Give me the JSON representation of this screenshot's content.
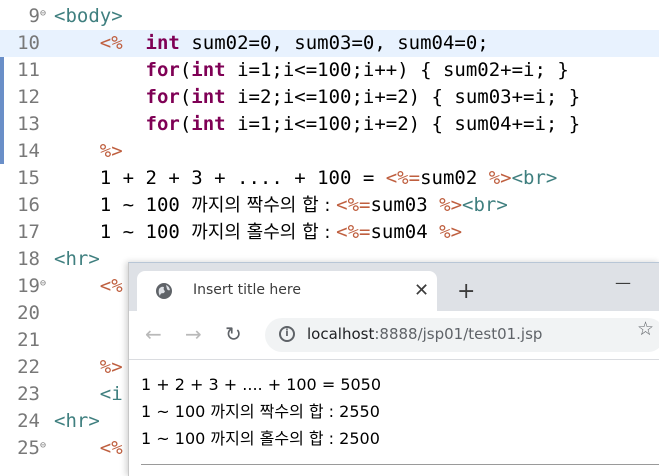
{
  "editor": {
    "lines": [
      {
        "num": "9",
        "fold": true,
        "segments": [
          {
            "t": "<body>",
            "c": "tag"
          }
        ]
      },
      {
        "num": "10",
        "fold": false,
        "highlight": true,
        "segments": [
          {
            "t": "    ",
            "c": "txt"
          },
          {
            "t": "<%",
            "c": "jsp"
          },
          {
            "t": "  ",
            "c": "txt"
          },
          {
            "t": "int",
            "c": "kw"
          },
          {
            "t": " sum02=0, sum03=0, sum04=0;",
            "c": "txt"
          }
        ]
      },
      {
        "num": "11",
        "fold": false,
        "segments": [
          {
            "t": "        ",
            "c": "txt"
          },
          {
            "t": "for",
            "c": "kw"
          },
          {
            "t": "(",
            "c": "txt"
          },
          {
            "t": "int",
            "c": "kw"
          },
          {
            "t": " i=1;i<=100;i++) { sum02+=i; }",
            "c": "txt"
          }
        ]
      },
      {
        "num": "12",
        "fold": false,
        "segments": [
          {
            "t": "        ",
            "c": "txt"
          },
          {
            "t": "for",
            "c": "kw"
          },
          {
            "t": "(",
            "c": "txt"
          },
          {
            "t": "int",
            "c": "kw"
          },
          {
            "t": " i=2;i<=100;i+=2) { sum03+=i; }",
            "c": "txt"
          }
        ]
      },
      {
        "num": "13",
        "fold": false,
        "segments": [
          {
            "t": "        ",
            "c": "txt"
          },
          {
            "t": "for",
            "c": "kw"
          },
          {
            "t": "(",
            "c": "txt"
          },
          {
            "t": "int",
            "c": "kw"
          },
          {
            "t": " i=1;i<=100;i+=2) { sum04+=i; }",
            "c": "txt"
          }
        ]
      },
      {
        "num": "14",
        "fold": false,
        "segments": [
          {
            "t": "    ",
            "c": "txt"
          },
          {
            "t": "%>",
            "c": "jsp"
          }
        ]
      },
      {
        "num": "15",
        "fold": false,
        "segments": [
          {
            "t": "    1 + 2 + 3 + .... + 100 = ",
            "c": "txt"
          },
          {
            "t": "<%=",
            "c": "jsp"
          },
          {
            "t": "sum02 ",
            "c": "txt"
          },
          {
            "t": "%>",
            "c": "jsp"
          },
          {
            "t": "<br>",
            "c": "tag"
          }
        ]
      },
      {
        "num": "16",
        "fold": false,
        "segments": [
          {
            "t": "    1 ~ 100 ",
            "c": "txt"
          },
          {
            "t": "까지의 짝수의 합 : ",
            "c": "txt kor"
          },
          {
            "t": "<%=",
            "c": "jsp"
          },
          {
            "t": "sum03 ",
            "c": "txt"
          },
          {
            "t": "%>",
            "c": "jsp"
          },
          {
            "t": "<br>",
            "c": "tag"
          }
        ]
      },
      {
        "num": "17",
        "fold": false,
        "segments": [
          {
            "t": "    1 ~ 100 ",
            "c": "txt"
          },
          {
            "t": "까지의 홀수의 합 : ",
            "c": "txt kor"
          },
          {
            "t": "<%=",
            "c": "jsp"
          },
          {
            "t": "sum04 ",
            "c": "txt"
          },
          {
            "t": "%>",
            "c": "jsp"
          }
        ]
      },
      {
        "num": "18",
        "fold": false,
        "segments": [
          {
            "t": "<hr>",
            "c": "tag"
          }
        ]
      },
      {
        "num": "19",
        "fold": true,
        "segments": [
          {
            "t": "    ",
            "c": "txt"
          },
          {
            "t": "<%",
            "c": "jsp"
          }
        ]
      },
      {
        "num": "20",
        "fold": false,
        "segments": []
      },
      {
        "num": "21",
        "fold": false,
        "segments": []
      },
      {
        "num": "22",
        "fold": false,
        "segments": [
          {
            "t": "    ",
            "c": "txt"
          },
          {
            "t": "%>",
            "c": "jsp"
          }
        ]
      },
      {
        "num": "23",
        "fold": false,
        "segments": [
          {
            "t": "    ",
            "c": "txt"
          },
          {
            "t": "<i",
            "c": "tag"
          }
        ]
      },
      {
        "num": "24",
        "fold": false,
        "segments": [
          {
            "t": "<hr>",
            "c": "tag"
          }
        ]
      },
      {
        "num": "25",
        "fold": true,
        "segments": [
          {
            "t": "    ",
            "c": "txt"
          },
          {
            "t": "<%",
            "c": "jsp"
          }
        ]
      }
    ]
  },
  "browser": {
    "tab_title": "Insert title here",
    "tab_close": "✕",
    "new_tab": "+",
    "minimize": "—",
    "url_host": "localhost",
    "url_path": ":8888/jsp01/test01.jsp",
    "output_lines": [
      "1 + 2 + 3 + .... + 100 = 5050",
      "1 ~ 100 까지의 짝수의 합 : 2550",
      "1 ~ 100 까지의 홀수의 합 : 2500"
    ]
  },
  "icons": {
    "back": "arrow-back-icon",
    "forward": "arrow-forward-icon",
    "reload": "reload-icon",
    "info": "info-icon",
    "star": "bookmark-star-icon",
    "globe": "globe-icon"
  }
}
